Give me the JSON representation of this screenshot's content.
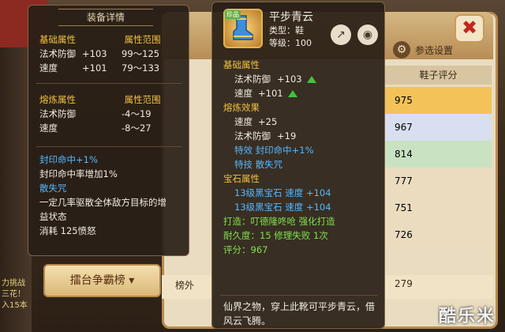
{
  "background": {
    "close_icon": "✖",
    "settings_label": "参选设置",
    "column_header": "鞋子评分",
    "scores": [
      "975",
      "967",
      "814",
      "777",
      "751",
      "726"
    ],
    "score_colors": [
      "#f3c35a",
      "#d7dff0",
      "#c9e2c2",
      "#ebdcc0",
      "#ebdcc0",
      "#ebdcc0"
    ],
    "rank_button": "擂台争霸榜",
    "bottom_row_label": "榜外",
    "bottom_row_value": "279",
    "watermark": "酷乐米",
    "left_bottom_text": [
      "力挑战",
      "三花！",
      "入15本"
    ]
  },
  "left_panel": {
    "title": "装备详情",
    "basic_header": "基础属性",
    "basic_range_header": "属性范围",
    "basic_rows": [
      {
        "name": "法术防御",
        "value": "+103",
        "range": "99～125"
      },
      {
        "name": "速度",
        "value": "+101",
        "range": "79～133"
      }
    ],
    "smelt_header": "熔炼属性",
    "smelt_range_header": "属性范围",
    "smelt_rows": [
      {
        "name": "法术防御",
        "range": "-4～19"
      },
      {
        "name": "速度",
        "range": "-8～27"
      }
    ],
    "seal_title": "封印命中+1%",
    "seal_desc": "封印命中率增加1%",
    "skill_title": "散失咒",
    "skill_desc_1": "一定几率驱散全体敌方目标的增",
    "skill_desc_2": "益状态",
    "skill_cost": "消耗 125愤怒"
  },
  "right_panel": {
    "badge": "珍品",
    "name": "平步青云",
    "type": "类型：鞋",
    "level": "等级：100",
    "basic_header": "基础属性",
    "basic_rows": [
      {
        "name": "法术防御",
        "value": "+103"
      },
      {
        "name": "速度",
        "value": "+101"
      }
    ],
    "smelt_header": "熔炼效果",
    "smelt_rows": [
      {
        "name": "速度",
        "value": "+25"
      },
      {
        "name": "法术防御",
        "value": "+19"
      }
    ],
    "special_effect": "特效  封印命中+1%",
    "special_skill": "特技  散失咒",
    "gem_header": "宝石属性",
    "gem_rows": [
      "13级黑宝石  速度  +104",
      "13级黑宝石  速度  +104"
    ],
    "forge": "打造：叮德隆咚呛  强化打造",
    "durability": "耐久度：15 修理失败 1次",
    "score": "评分：967",
    "description": "仙界之物，穿上此靴可平步青云，借风云飞腾。"
  }
}
